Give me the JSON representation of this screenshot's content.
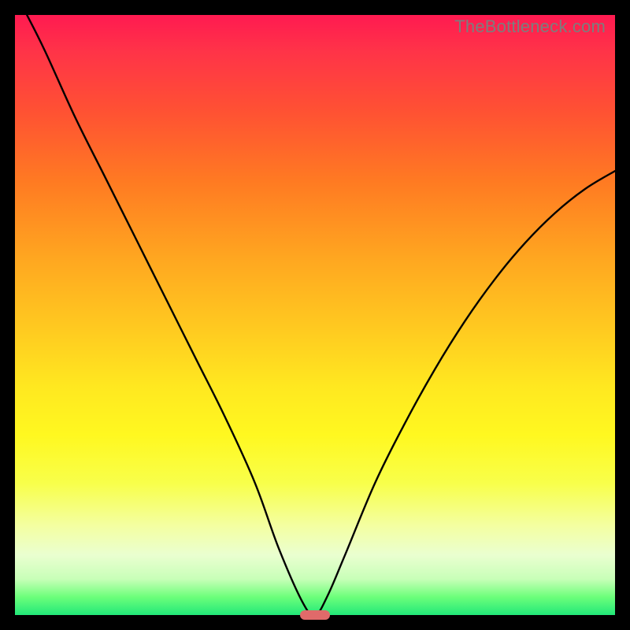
{
  "watermark": "TheBottleneck.com",
  "chart_data": {
    "type": "line",
    "title": "",
    "xlabel": "",
    "ylabel": "",
    "xlim": [
      0,
      100
    ],
    "ylim": [
      0,
      100
    ],
    "grid": false,
    "legend": false,
    "series": [
      {
        "name": "bottleneck-curve",
        "x": [
          2,
          5,
          10,
          15,
          20,
          25,
          30,
          35,
          40,
          44,
          48,
          50,
          52,
          55,
          60,
          65,
          70,
          75,
          80,
          85,
          90,
          95,
          100
        ],
        "values": [
          100,
          94,
          83,
          73,
          63,
          53,
          43,
          33,
          22,
          11,
          2,
          0,
          3,
          10,
          22,
          32,
          41,
          49,
          56,
          62,
          67,
          71,
          74
        ]
      }
    ],
    "minimum_marker": {
      "x": 50,
      "y": 0
    },
    "gradient_stops": [
      {
        "pct": 0,
        "color": "#ff1a51"
      },
      {
        "pct": 28,
        "color": "#ff7b22"
      },
      {
        "pct": 62,
        "color": "#ffe820"
      },
      {
        "pct": 100,
        "color": "#22e879"
      }
    ]
  }
}
